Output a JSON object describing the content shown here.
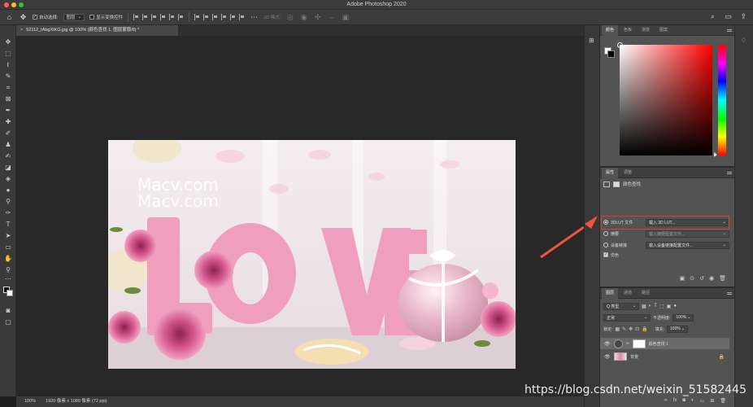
{
  "window": {
    "title": "Adobe Photoshop 2020"
  },
  "options_bar": {
    "auto_select_label": "自动选择:",
    "auto_select_target": "图层",
    "show_transform_label": "显示变换控件",
    "mode_3d_label": "3D 模式:"
  },
  "document": {
    "tab_title": "52112_tAbgXtKG.jpg @ 100% (颜色查找 1, 图层蒙版/8) *",
    "watermark_text": "Macv.com",
    "image_words": "LOVE"
  },
  "status": {
    "zoom": "100%",
    "dimensions": "1920 像素 x 1080 像素 (72 ppi)"
  },
  "color_panel": {
    "tabs": [
      "颜色",
      "色板",
      "渐变",
      "图案"
    ]
  },
  "properties_panel": {
    "tabs": [
      "属性",
      "调整"
    ],
    "adjustment_title": "颜色查找",
    "rows": [
      {
        "label": "3DLUT 文件",
        "value": "载入 3D LUT...",
        "selected": true,
        "kind": "radio"
      },
      {
        "label": "摘要",
        "value": "载入摘要配置文件...",
        "selected": false,
        "kind": "radio"
      },
      {
        "label": "设备链接",
        "value": "载入设备链接配置文件...",
        "selected": false,
        "kind": "radio"
      }
    ],
    "dither_label": "仿色",
    "dither_checked": true
  },
  "layers_panel": {
    "tabs": [
      "图层",
      "通道",
      "路径"
    ],
    "filter_kind": "Q 类型",
    "blend_mode": "正常",
    "opacity_label": "不透明度:",
    "opacity_value": "100%",
    "lock_label": "锁定:",
    "fill_label": "填充:",
    "fill_value": "100%",
    "layers": [
      {
        "name": "颜色查找 1",
        "type": "adjustment",
        "selected": true
      },
      {
        "name": "背景",
        "type": "image",
        "selected": false
      }
    ]
  },
  "footer_watermark": "https://blog.csdn.net/weixin_51582445",
  "colors": {
    "highlight": "#e23a2e",
    "arrow": "#ee5540",
    "panel_bg": "#535353",
    "canvas_bg": "#282828"
  }
}
